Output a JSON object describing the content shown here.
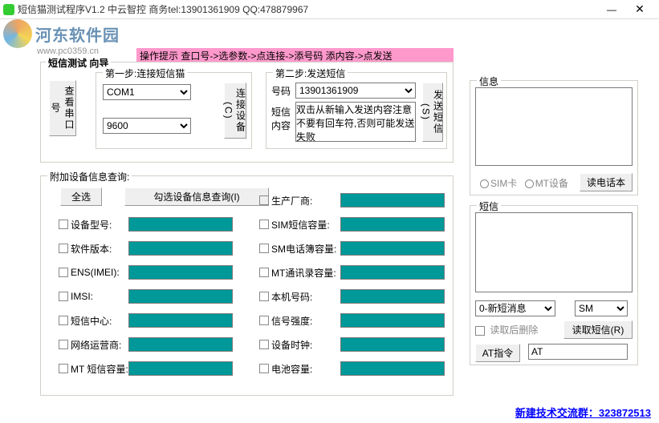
{
  "title": "短信猫测试程序V1.2      中云智控  商务tel:13901361909   QQ:478879967",
  "watermark": {
    "name": "河东软件园",
    "url": "www.pc0359.cn"
  },
  "hint": "操作提示 查口号->选参数->点连接->添号码 添内容->点发送",
  "wizard": {
    "label": "短信测试 向导",
    "step1": {
      "title": "第一步:连接短信猫",
      "btn_view_port": "查看串口号",
      "com": "COM1",
      "baud": "9600",
      "btn_connect": "连接设备(C)"
    },
    "step2": {
      "title": "第二步:发送短信",
      "lbl_number": "号码",
      "number": "13901361909",
      "lbl_content": "短信内容",
      "content": "双击从新输入发送内容注意不要有回车符,否则可能发送失败",
      "btn_send": "发送短信(S)"
    }
  },
  "query": {
    "title": "附加设备信息查询:",
    "btn_all": "全选",
    "btn_query": "勾选设备信息查询(I)",
    "left": [
      {
        "k": "设备型号:"
      },
      {
        "k": "软件版本:"
      },
      {
        "k": "ENS(IMEI):"
      },
      {
        "k": "IMSI:"
      },
      {
        "k": "短信中心:"
      },
      {
        "k": "网络运营商:"
      },
      {
        "k": "MT 短信容量:"
      }
    ],
    "right": [
      {
        "k": "生产厂商:"
      },
      {
        "k": "SIM短信容量:"
      },
      {
        "k": "SM电话簿容量:"
      },
      {
        "k": "MT通讯录容量:"
      },
      {
        "k": "本机号码:"
      },
      {
        "k": "信号强度:"
      },
      {
        "k": "设备时钟:"
      },
      {
        "k": "电池容量:"
      }
    ]
  },
  "info_panel": {
    "title": "信息",
    "opt_sim": "SIM卡",
    "opt_mt": "MT设备",
    "btn_phonebook": "读电话本"
  },
  "sms_panel": {
    "title": "短信",
    "sel1": "0-新短消息",
    "sel2": "SM",
    "chk_del": "读取后删除",
    "btn_read": "读取短信(R)",
    "lbl_at": "AT指令",
    "at_val": "AT"
  },
  "footer": "新建技术交流群：323872513"
}
